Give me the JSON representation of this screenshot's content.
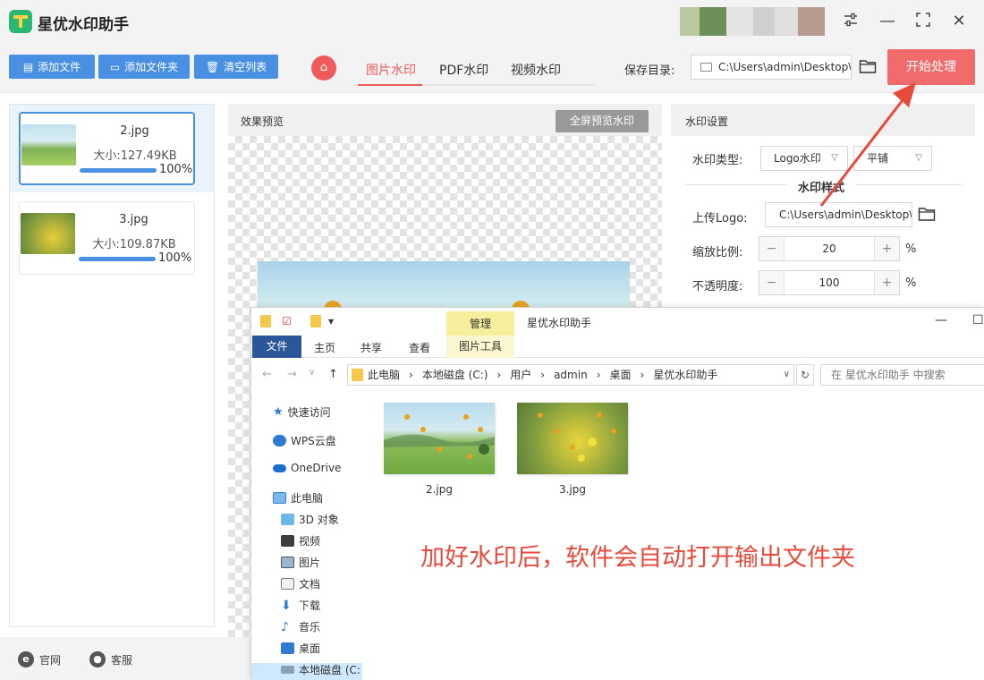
{
  "app": {
    "title": "星优水印助手",
    "accent": "#4a90e2",
    "danger": "#f06b6b"
  },
  "window_controls": {
    "settings_icon": "sliders-icon",
    "minimize": "—",
    "maximize": "⛶",
    "close": "✕"
  },
  "toolbar": {
    "add_file": "添加文件",
    "add_folder": "添加文件夹",
    "clear_list": "清空列表",
    "tabs": [
      "图片水印",
      "PDF水印",
      "视频水印"
    ],
    "active_tab": "图片水印",
    "save_dir_label": "保存目录:",
    "save_dir_value": "C:\\Users\\admin\\Desktop\\",
    "start_button": "开始处理"
  },
  "files": [
    {
      "name": "2.jpg",
      "size": "大小:127.49KB",
      "progress_pct": 100,
      "progress_label": "100%",
      "selected": true
    },
    {
      "name": "3.jpg",
      "size": "大小:109.87KB",
      "progress_pct": 100,
      "progress_label": "100%",
      "selected": false
    }
  ],
  "footer": {
    "website": "官网",
    "support": "客服"
  },
  "preview": {
    "title": "效果预览",
    "fullscreen_button": "全屏预览水印"
  },
  "settings": {
    "title": "水印设置",
    "type_label": "水印类型:",
    "type_value": "Logo水印",
    "layout_value": "平铺",
    "style_title": "水印样式",
    "upload_logo_label": "上传Logo:",
    "logo_path": "C:\\Users\\admin\\Desktop\\",
    "scale_label": "缩放比例:",
    "scale_value": "20",
    "opacity_label": "不透明度:",
    "opacity_value": "100",
    "unit": "%",
    "minus": "−",
    "plus": "+"
  },
  "explorer": {
    "manage_tab": "管理",
    "window_title": "星优水印助手",
    "ribbon_tabs": [
      "文件",
      "主页",
      "共享",
      "查看"
    ],
    "picture_tools": "图片工具",
    "breadcrumb": [
      "此电脑",
      "本地磁盘 (C:)",
      "用户",
      "admin",
      "桌面",
      "星优水印助手"
    ],
    "search_placeholder": "在 星优水印助手 中搜索",
    "nav_items": [
      {
        "label": "快速访问",
        "icon": "star-icon"
      },
      {
        "label": "WPS云盘",
        "icon": "cloud-icon"
      },
      {
        "label": "OneDrive",
        "icon": "onedrive-icon"
      },
      {
        "label": "此电脑",
        "icon": "computer-icon"
      },
      {
        "label": "3D 对象",
        "icon": "cube-icon"
      },
      {
        "label": "视频",
        "icon": "video-icon"
      },
      {
        "label": "图片",
        "icon": "picture-icon"
      },
      {
        "label": "文档",
        "icon": "document-icon"
      },
      {
        "label": "下载",
        "icon": "download-icon"
      },
      {
        "label": "音乐",
        "icon": "music-icon"
      },
      {
        "label": "桌面",
        "icon": "desktop-icon"
      },
      {
        "label": "本地磁盘 (C:",
        "icon": "drive-icon"
      }
    ],
    "files": [
      "2.jpg",
      "3.jpg"
    ]
  },
  "annotation": {
    "text": "加好水印后，软件会自动打开输出文件夹",
    "color": "#e84a3b"
  }
}
